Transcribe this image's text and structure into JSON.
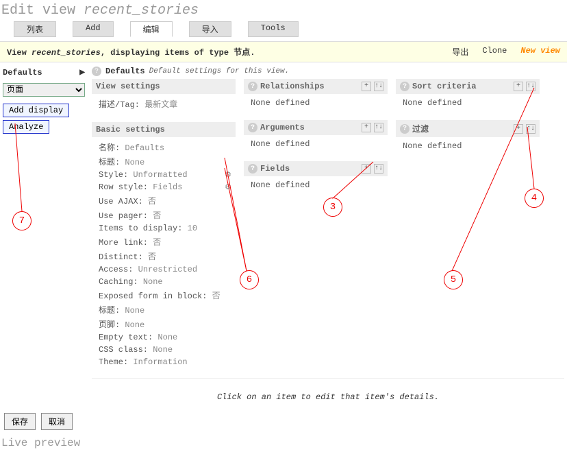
{
  "title_prefix": "Edit view ",
  "title_name": "recent_stories",
  "tabs": {
    "list": "列表",
    "add": "Add",
    "edit": "编辑",
    "import": "导入",
    "tools": "Tools"
  },
  "info": {
    "view_label": "View ",
    "view_name": "recent_stories",
    "rest": ", displaying items of type 节点.",
    "export": "导出",
    "clone": "Clone",
    "new_view": "New view"
  },
  "sidebar": {
    "defaults": "Defaults",
    "dropdown": "页面",
    "add_display": "Add display",
    "analyze": "Analyze"
  },
  "section": {
    "title": "Defaults",
    "subtitle": "Default settings for this view."
  },
  "viewsettings": {
    "title": "View settings",
    "desc_lbl": "描述/Tag:",
    "desc_val": "最新文章"
  },
  "basic": {
    "title": "Basic settings",
    "rows": [
      {
        "lbl": "名称:",
        "val": "Defaults",
        "gear": false
      },
      {
        "lbl": "标题:",
        "val": "None",
        "gear": false
      },
      {
        "lbl": "Style:",
        "val": "Unformatted",
        "gear": true
      },
      {
        "lbl": "Row style:",
        "val": "Fields",
        "gear": true
      },
      {
        "lbl": "Use AJAX:",
        "val": "否",
        "gear": false
      },
      {
        "lbl": "Use pager:",
        "val": "否",
        "gear": false
      },
      {
        "lbl": "Items to display:",
        "val": "10",
        "gear": false
      },
      {
        "lbl": "More link:",
        "val": "否",
        "gear": false
      },
      {
        "lbl": "Distinct:",
        "val": "否",
        "gear": false
      },
      {
        "lbl": "Access:",
        "val": "Unrestricted",
        "gear": false
      },
      {
        "lbl": "Caching:",
        "val": "None",
        "gear": false
      },
      {
        "lbl": "Exposed form in block:",
        "val": "否",
        "gear": false
      },
      {
        "lbl": "标题:",
        "val": "None",
        "gear": false
      },
      {
        "lbl": "页脚:",
        "val": "None",
        "gear": false
      },
      {
        "lbl": "Empty text:",
        "val": "None",
        "gear": false
      },
      {
        "lbl": "CSS class:",
        "val": "None",
        "gear": false
      },
      {
        "lbl": "Theme:",
        "val": "Information",
        "gear": false
      }
    ]
  },
  "relationships": {
    "title": "Relationships",
    "body": "None defined"
  },
  "arguments": {
    "title": "Arguments",
    "body": "None defined"
  },
  "fields": {
    "title": "Fields",
    "body": "None defined"
  },
  "sort": {
    "title": "Sort criteria",
    "body": "None defined"
  },
  "filter": {
    "title": "过滤",
    "body": "None defined"
  },
  "hint": "Click on an item to edit that item's details.",
  "save": "保存",
  "cancel": "取消",
  "live_preview": "Live preview",
  "icons": {
    "plus": "+",
    "updown": "↑↓",
    "gear": "⚙"
  },
  "annotations": [
    "3",
    "4",
    "5",
    "6",
    "7"
  ]
}
